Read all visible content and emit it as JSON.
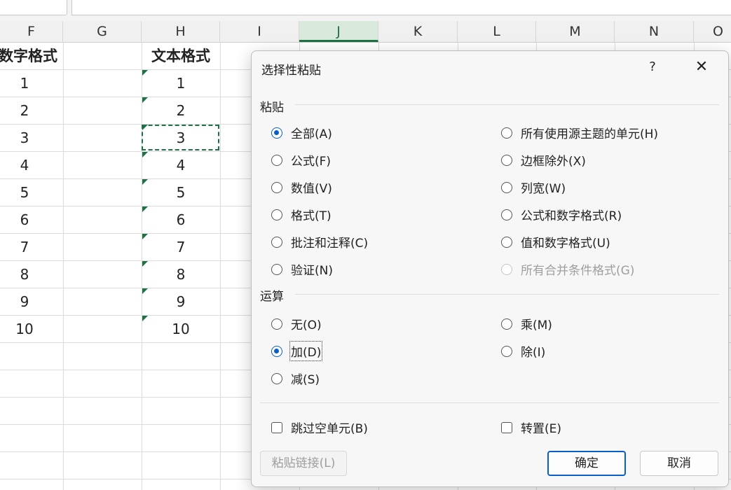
{
  "spreadsheet": {
    "columns": [
      "F",
      "G",
      "H",
      "I",
      "J",
      "K",
      "L",
      "M",
      "N",
      "O"
    ],
    "selected_column": "J",
    "header_row": {
      "F": "数字格式",
      "G": "",
      "H": "文本格式"
    },
    "column_F": [
      "1",
      "2",
      "3",
      "4",
      "5",
      "6",
      "7",
      "8",
      "9",
      "10"
    ],
    "column_H": [
      "1",
      "2",
      "3",
      "4",
      "5",
      "6",
      "7",
      "8",
      "9",
      "10"
    ]
  },
  "dialog": {
    "title": "选择性粘贴",
    "help": "?",
    "close": "✕",
    "paste_section": {
      "label": "粘贴",
      "selected": "全部(A)",
      "left": [
        "全部(A)",
        "公式(F)",
        "数值(V)",
        "格式(T)",
        "批注和注释(C)",
        "验证(N)"
      ],
      "right": [
        "所有使用源主题的单元(H)",
        "边框除外(X)",
        "列宽(W)",
        "公式和数字格式(R)",
        "值和数字格式(U)",
        "所有合并条件格式(G)"
      ],
      "disabled": [
        "所有合并条件格式(G)"
      ]
    },
    "operation_section": {
      "label": "运算",
      "selected": "加(D)",
      "left": [
        "无(O)",
        "加(D)",
        "减(S)"
      ],
      "right": [
        "乘(M)",
        "除(I)"
      ]
    },
    "checkboxes": {
      "skip_blanks": {
        "label": "跳过空单元(B)",
        "checked": false
      },
      "transpose": {
        "label": "转置(E)",
        "checked": false
      }
    },
    "buttons": {
      "paste_link": "粘贴链接(L)",
      "ok": "确定",
      "cancel": "取消"
    }
  }
}
